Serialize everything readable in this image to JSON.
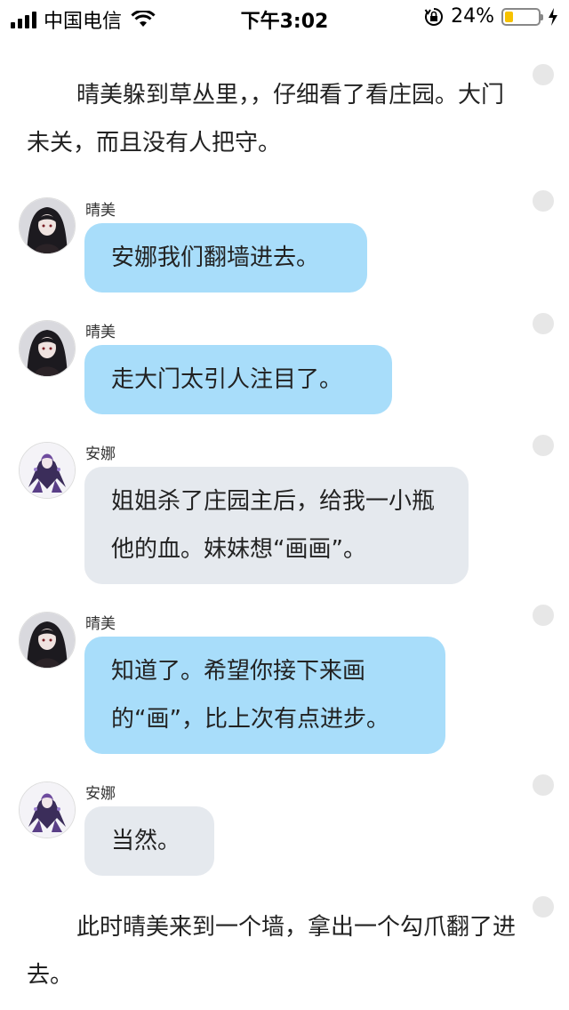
{
  "status_bar": {
    "carrier": "中国电信",
    "time": "下午3:02",
    "battery_percent_text": "24%",
    "battery_level": 0.24,
    "icons": [
      "signal-icon",
      "wifi-icon",
      "rotation-lock-icon",
      "battery-icon",
      "charging-bolt-icon"
    ]
  },
  "story": {
    "narration_1": "晴美躲到草丛里，，仔细看了看庄园。大门未关，而且没有人把守。",
    "messages": [
      {
        "speaker": "晴美",
        "text": "安娜我们翻墙进去。"
      },
      {
        "speaker": "晴美",
        "text": "走大门太引人注目了。"
      },
      {
        "speaker": "安娜",
        "text": "姐姐杀了庄园主后，给我一小瓶他的血。妹妹想“画画”。"
      },
      {
        "speaker": "晴美",
        "text": "知道了。希望你接下来画的“画”，比上次有点进步。"
      },
      {
        "speaker": "安娜",
        "text": "当然。"
      }
    ],
    "narration_2": "此时晴美来到一个墙，拿出一个勾爪翻了进去。"
  },
  "colors": {
    "self_bubble": "#a8ddfa",
    "other_bubble": "#e5e9ee",
    "battery_fill": "#f7c200"
  }
}
